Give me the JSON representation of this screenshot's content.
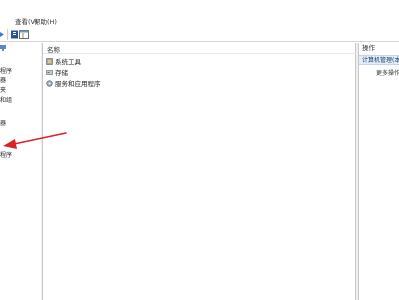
{
  "menu": {
    "view": "查看(V)",
    "help": "帮助(H)"
  },
  "left_tree": {
    "items": [
      "程序",
      "器",
      "夹",
      "和组",
      "器",
      "程序"
    ]
  },
  "center": {
    "column_name": "名称",
    "rows": [
      {
        "label": "系统工具",
        "icon": "tools-icon"
      },
      {
        "label": "存储",
        "icon": "storage-icon"
      },
      {
        "label": "服务和应用程序",
        "icon": "services-icon"
      }
    ]
  },
  "actions": {
    "header": "操作",
    "selected": "计算机管理(本",
    "more": "更多操作"
  },
  "colors": {
    "annotation_arrow": "#d8232a",
    "actions_highlight": "#e4edf7"
  }
}
